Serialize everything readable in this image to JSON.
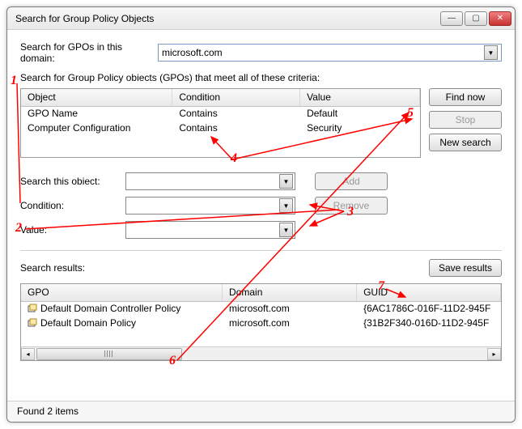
{
  "window": {
    "title": "Search for Group Policy Objects"
  },
  "domain_row": {
    "label": "Search for GPOs in this domain:",
    "value": "microsoft.com"
  },
  "criteria": {
    "label": "Search for Group Policy obiects (GPOs) that meet all of these criteria:",
    "headers": {
      "object": "Object",
      "condition": "Condition",
      "value": "Value"
    },
    "rows": [
      {
        "object": "GPO Name",
        "condition": "Contains",
        "value": "Default"
      },
      {
        "object": "Computer Configuration",
        "condition": "Contains",
        "value": "Security"
      }
    ],
    "buttons": {
      "find": "Find now",
      "stop": "Stop",
      "new": "New search"
    }
  },
  "form": {
    "search_object": {
      "label": "Search this obiect:",
      "value": ""
    },
    "condition": {
      "label": "Condition:",
      "value": ""
    },
    "value_field": {
      "label": "Value:",
      "value": ""
    },
    "add": "Add",
    "remove": "Remove"
  },
  "results": {
    "label": "Search results:",
    "save": "Save results",
    "headers": {
      "gpo": "GPO",
      "domain": "Domain",
      "guid": "GUID"
    },
    "rows": [
      {
        "gpo": "Default Domain Controller Policy",
        "domain": "microsoft.com",
        "guid": "{6AC1786C-016F-11D2-945F"
      },
      {
        "gpo": "Default Domain Policy",
        "domain": "microsoft.com",
        "guid": "{31B2F340-016D-11D2-945F"
      }
    ]
  },
  "status": "Found 2 items",
  "annotations": [
    "1",
    "2",
    "3",
    "4",
    "5",
    "6",
    "7"
  ]
}
